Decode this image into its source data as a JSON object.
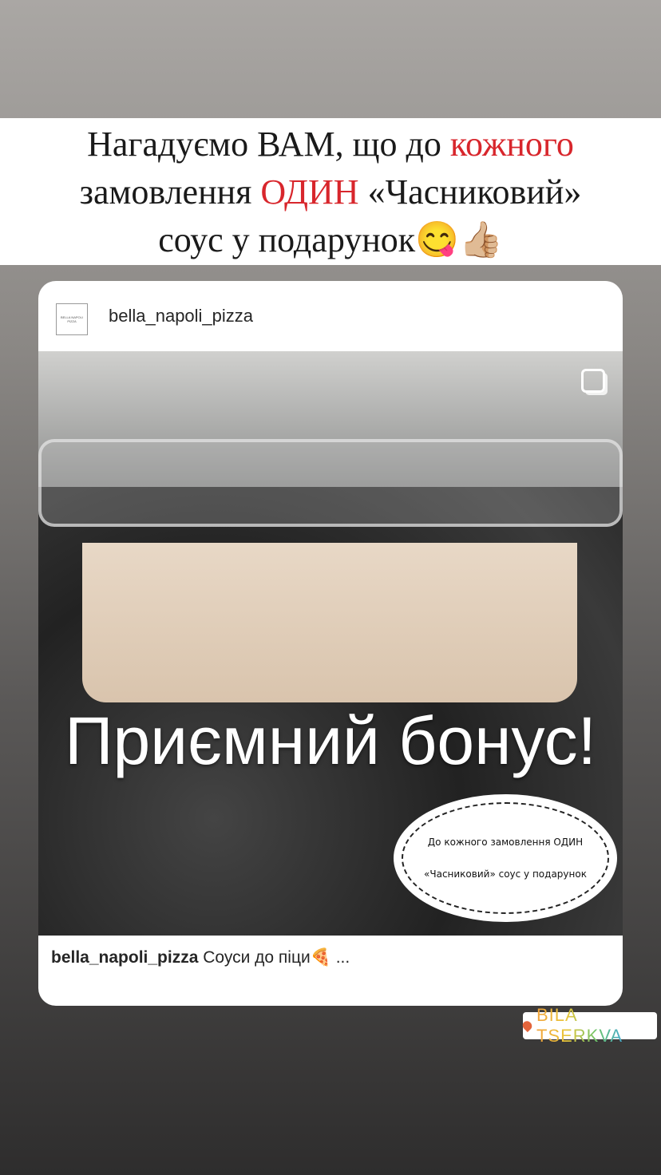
{
  "banner": {
    "line1_a": "Нагадуємо ВАМ, що до ",
    "line1_red": "кожного",
    "line2_a": "замовлення ",
    "line2_red": "ОДИН",
    "line2_b": " «Часниковий»",
    "line3": "соус у подарунок😋👍🏼"
  },
  "post": {
    "username": "bella_napoli_pizza",
    "logo_text": "BELLA NAPOLI PIZZA",
    "image_title": "Приємний бонус!",
    "cloud_line1": "До кожного замовлення ОДИН",
    "cloud_line2": "«Часниковий» соус у подарунок",
    "caption_user": "bella_napoli_pizza",
    "caption_text": " Соуси до піци🍕 ..."
  },
  "location": {
    "label": "BILA TSERKVA",
    "icon": "location-pin-icon"
  },
  "colors": {
    "accent_red": "#d8262c"
  }
}
